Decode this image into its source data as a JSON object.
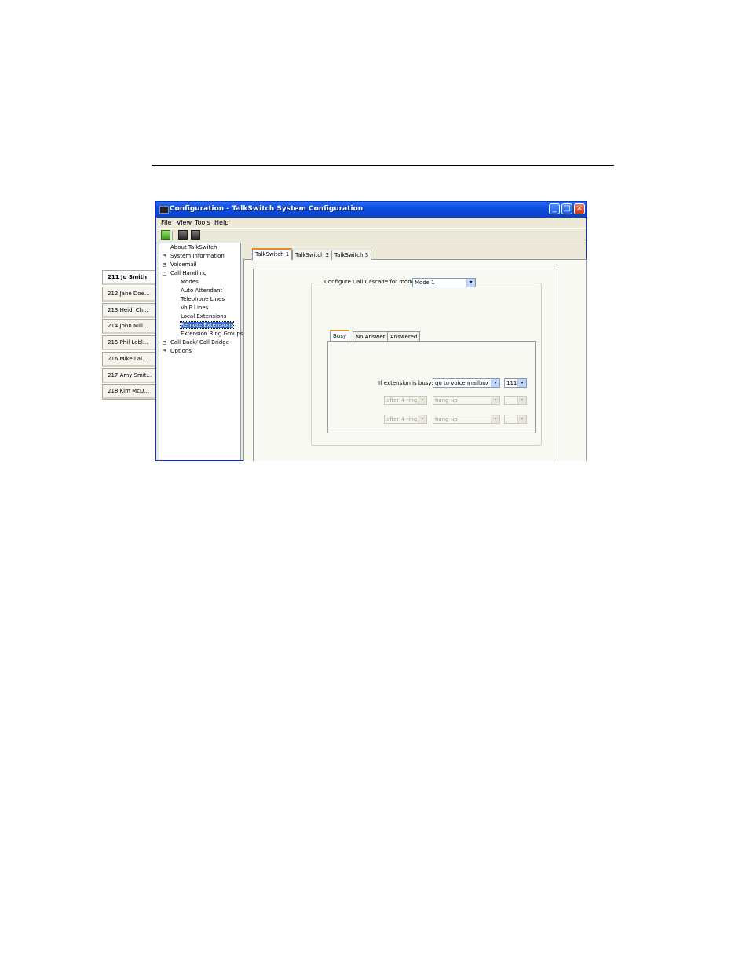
{
  "window": {
    "title": "Configuration - TalkSwitch System Configuration",
    "controls": {
      "minimize": "_",
      "maximize": "□",
      "close": "×"
    }
  },
  "menu": [
    "File",
    "View",
    "Tools",
    "Help"
  ],
  "toolbar": {
    "icons": [
      "green-arrow-icon",
      "download-icon",
      "upload-icon"
    ]
  },
  "tree": {
    "items": [
      {
        "label": "About TalkSwitch",
        "expander": ""
      },
      {
        "label": "System Information",
        "expander": "+"
      },
      {
        "label": "Voicemail",
        "expander": "+"
      },
      {
        "label": "Call Handling",
        "expander": "-"
      },
      {
        "label": "Modes",
        "expander": ""
      },
      {
        "label": "Auto Attendant",
        "expander": ""
      },
      {
        "label": "Telephone Lines",
        "expander": ""
      },
      {
        "label": "VoIP Lines",
        "expander": ""
      },
      {
        "label": "Local Extensions",
        "expander": ""
      },
      {
        "label": "Remote Extensions",
        "expander": "",
        "selected": true
      },
      {
        "label": "Extension Ring Groups",
        "expander": ""
      },
      {
        "label": "Call Back/ Call Bridge",
        "expander": "+"
      },
      {
        "label": "Options",
        "expander": "+"
      }
    ]
  },
  "unit_tabs": [
    "TalkSwitch 1",
    "TalkSwitch 2",
    "TalkSwitch 3"
  ],
  "extensions": [
    "211 Jo Smith",
    "212 Jane Doe...",
    "213 Heidi Ch...",
    "214 John Mill...",
    "215 Phil Lebl...",
    "216 Mike Lal...",
    "217 Amy Smit...",
    "218 Kim McD..."
  ],
  "cascade": {
    "label": "Configure Call Cascade for mode:",
    "mode": "Mode 1"
  },
  "cascade_tabs": [
    "Busy",
    "No Answer",
    "Answered"
  ],
  "busy": {
    "label": "If extension is busy:",
    "row1": {
      "action": "go to voice mailbox",
      "target": "111"
    },
    "row2": {
      "rings": "after 4 rings",
      "action": "hang up",
      "target": ""
    },
    "row3": {
      "rings": "after 4 rings",
      "action": "hang up",
      "target": ""
    }
  },
  "arrow_glyph": "▾"
}
